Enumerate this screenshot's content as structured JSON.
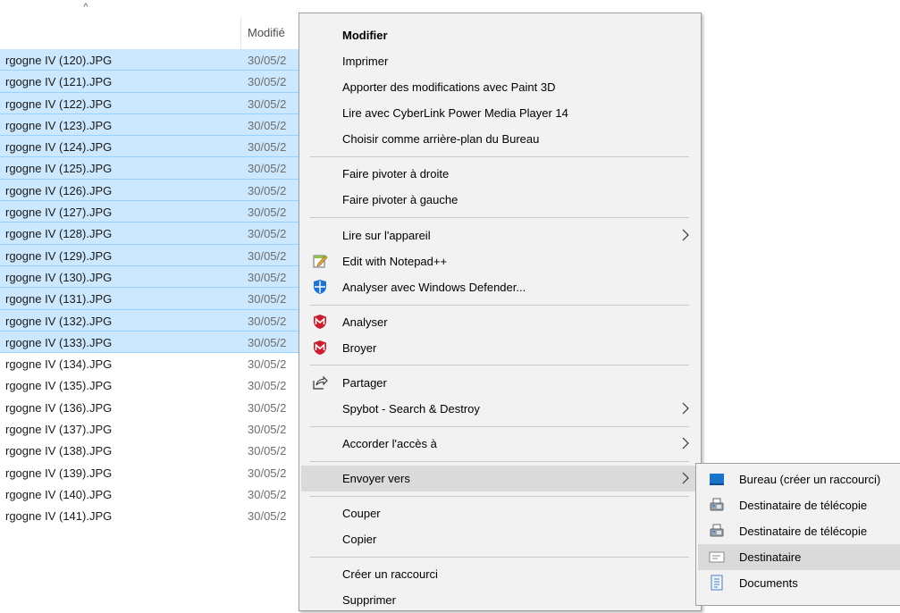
{
  "list": {
    "sort_glyph": "^",
    "columns": {
      "modified": "Modifié"
    },
    "rows": [
      {
        "name": "rgogne IV (120).JPG",
        "date": "30/05/2",
        "selected": true
      },
      {
        "name": "rgogne IV (121).JPG",
        "date": "30/05/2",
        "selected": true
      },
      {
        "name": "rgogne IV (122).JPG",
        "date": "30/05/2",
        "selected": true
      },
      {
        "name": "rgogne IV (123).JPG",
        "date": "30/05/2",
        "selected": true
      },
      {
        "name": "rgogne IV (124).JPG",
        "date": "30/05/2",
        "selected": true
      },
      {
        "name": "rgogne IV (125).JPG",
        "date": "30/05/2",
        "selected": true
      },
      {
        "name": "rgogne IV (126).JPG",
        "date": "30/05/2",
        "selected": true
      },
      {
        "name": "rgogne IV (127).JPG",
        "date": "30/05/2",
        "selected": true
      },
      {
        "name": "rgogne IV (128).JPG",
        "date": "30/05/2",
        "selected": true
      },
      {
        "name": "rgogne IV (129).JPG",
        "date": "30/05/2",
        "selected": true
      },
      {
        "name": "rgogne IV (130).JPG",
        "date": "30/05/2",
        "selected": true
      },
      {
        "name": "rgogne IV (131).JPG",
        "date": "30/05/2",
        "selected": true
      },
      {
        "name": "rgogne IV (132).JPG",
        "date": "30/05/2",
        "selected": true
      },
      {
        "name": "rgogne IV (133).JPG",
        "date": "30/05/2",
        "selected": true
      },
      {
        "name": "rgogne IV (134).JPG",
        "date": "30/05/2",
        "selected": false
      },
      {
        "name": "rgogne IV (135).JPG",
        "date": "30/05/2",
        "selected": false
      },
      {
        "name": "rgogne IV (136).JPG",
        "date": "30/05/2",
        "selected": false
      },
      {
        "name": "rgogne IV (137).JPG",
        "date": "30/05/2",
        "selected": false
      },
      {
        "name": "rgogne IV (138).JPG",
        "date": "30/05/2",
        "selected": false
      },
      {
        "name": "rgogne IV (139).JPG",
        "date": "30/05/2",
        "selected": false
      },
      {
        "name": "rgogne IV (140).JPG",
        "date": "30/05/2",
        "selected": false
      },
      {
        "name": "rgogne IV (141).JPG",
        "date": "30/05/2",
        "selected": false
      }
    ]
  },
  "context_menu": {
    "items": [
      {
        "label": "Modifier",
        "bold": true
      },
      {
        "label": "Imprimer"
      },
      {
        "label": "Apporter des modifications avec Paint 3D"
      },
      {
        "label": "Lire avec CyberLink Power Media Player 14"
      },
      {
        "label": "Choisir comme arrière-plan du Bureau"
      },
      {
        "label": "Faire pivoter à droite"
      },
      {
        "label": "Faire pivoter à gauche"
      },
      {
        "label": "Lire sur l'appareil",
        "submenu": true
      },
      {
        "label": "Edit with Notepad++",
        "icon": "notepadpp-icon"
      },
      {
        "label": "Analyser avec Windows Defender...",
        "icon": "windows-defender-icon"
      },
      {
        "label": "Analyser",
        "icon": "mcafee-icon"
      },
      {
        "label": "Broyer",
        "icon": "mcafee-icon"
      },
      {
        "label": "Partager",
        "icon": "share-icon"
      },
      {
        "label": "Spybot - Search & Destroy",
        "submenu": true
      },
      {
        "label": "Accorder l'accès à",
        "submenu": true
      },
      {
        "label": "Envoyer vers",
        "submenu": true,
        "hover": true
      },
      {
        "label": "Couper"
      },
      {
        "label": "Copier"
      },
      {
        "label": "Créer un raccourci"
      },
      {
        "label": "Supprimer"
      }
    ]
  },
  "send_to_submenu": {
    "items": [
      {
        "label": "Bureau (créer un raccourci)",
        "icon": "desktop-icon"
      },
      {
        "label": "Destinataire de télécopie",
        "icon": "fax-icon"
      },
      {
        "label": "Destinataire de télécopie",
        "icon": "fax-icon"
      },
      {
        "label": "Destinataire",
        "icon": "mail-recipient-icon",
        "hover": true
      },
      {
        "label": "Documents",
        "icon": "documents-icon"
      }
    ]
  },
  "colors": {
    "selection": "#cce8ff",
    "menu_bg": "#f2f2f2",
    "menu_hover": "#dadada"
  }
}
